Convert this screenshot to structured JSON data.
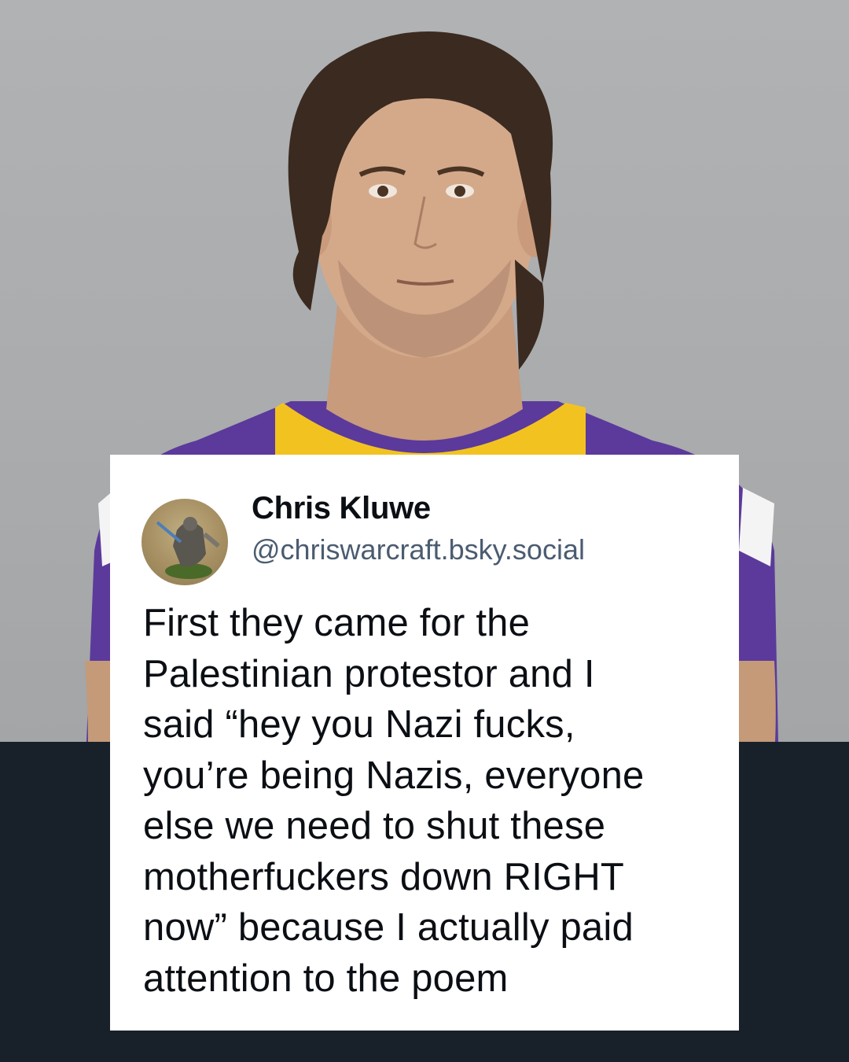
{
  "post": {
    "author_name": "Chris Kluwe",
    "author_handle": "@chriswarcraft.bsky.social",
    "body": "First they came for the\nPalestinian protestor and I\nsaid “hey you Nazi fucks,\nyou’re being Nazis, everyone\nelse we need to shut these\nmotherfuckers down RIGHT\nnow” because I actually paid\nattention to the poem"
  },
  "colors": {
    "background_band": "#18202a",
    "card": "#ffffff",
    "name_text": "#0b0f14",
    "handle_text": "#4b5c70",
    "jersey_purple": "#5b3a9b",
    "jersey_gold": "#f2c320"
  }
}
